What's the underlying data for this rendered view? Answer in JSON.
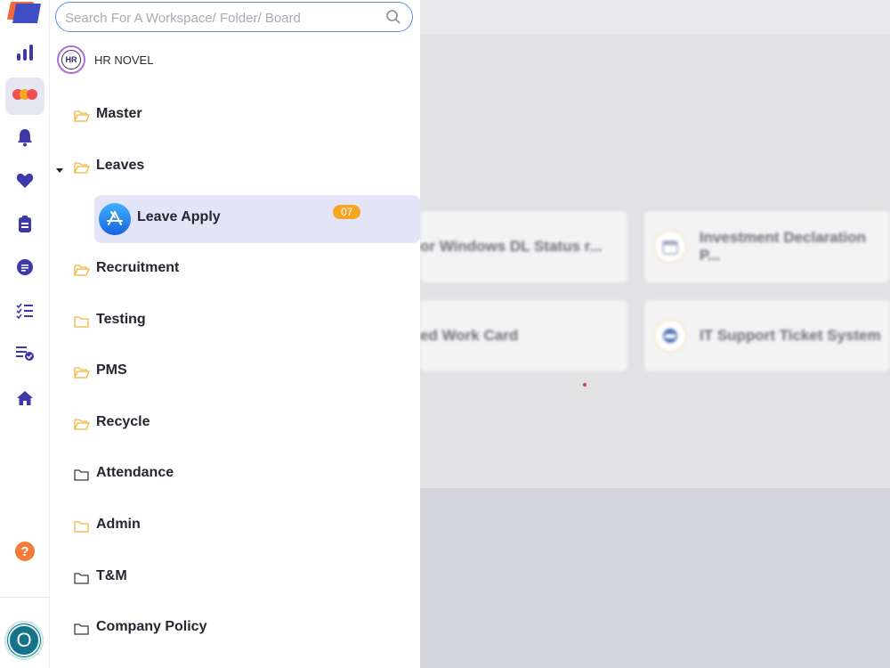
{
  "search": {
    "placeholder": "Search For A Workspace/ Folder/ Board"
  },
  "org": {
    "logo_text": "HR",
    "name": "HR NOVEL"
  },
  "folders": [
    {
      "label": "Master",
      "icon": "folder-open-icon",
      "color": "#f4b43a"
    },
    {
      "label": "Leaves",
      "icon": "folder-open-icon",
      "color": "#f4b43a",
      "expanded": true
    },
    {
      "label": "Recruitment",
      "icon": "folder-open-icon",
      "color": "#f4b43a"
    },
    {
      "label": "Testing",
      "icon": "folder-icon",
      "color": "#f4b43a"
    },
    {
      "label": "PMS",
      "icon": "folder-open-icon",
      "color": "#f4b43a"
    },
    {
      "label": "Recycle",
      "icon": "folder-open-icon",
      "color": "#f4b43a"
    },
    {
      "label": "Attendance",
      "icon": "folder-icon",
      "color": "#3a3a44"
    },
    {
      "label": "Admin",
      "icon": "folder-icon",
      "color": "#f4b43a"
    },
    {
      "label": "T&M",
      "icon": "folder-icon",
      "color": "#3a3a44"
    },
    {
      "label": "Company Policy",
      "icon": "folder-icon",
      "color": "#3a3a44"
    }
  ],
  "board": {
    "label": "Leave Apply",
    "badge": "07",
    "icon": "app-store-icon"
  },
  "rail": {
    "items": [
      "analytics-icon",
      "workspace-icon",
      "bell-icon",
      "heart-icon",
      "document-icon",
      "notes-icon",
      "checklist-icon",
      "task-done-icon",
      "home-icon"
    ],
    "help_icon": "help-icon",
    "avatar_letter": "O"
  },
  "background_cards": [
    {
      "label": "or Windows DL Status r..."
    },
    {
      "label": "Investment Declaration P..."
    },
    {
      "label": "ed Work Card"
    },
    {
      "label": "IT Support Ticket System"
    }
  ],
  "colors": {
    "accent": "#4a3fb5",
    "rail_icon": "#3d3aa8",
    "badge": "#f5a623",
    "active_bg": "#e3e4f5",
    "search_border": "#5c8fe6"
  }
}
